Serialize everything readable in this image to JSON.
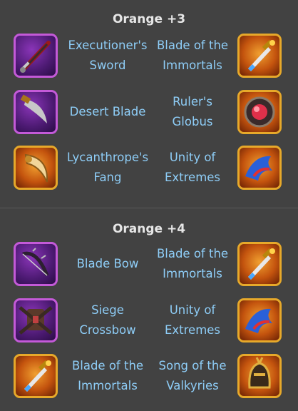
{
  "sections": [
    {
      "title": "Orange +3",
      "rows": [
        {
          "left": {
            "icon": "sword-icon",
            "name_lines": [
              "Executioner's",
              "Sword"
            ]
          },
          "right": {
            "icon": "dagger-icon",
            "name_lines": [
              "Blade of the",
              "Immortals"
            ]
          }
        },
        {
          "left": {
            "icon": "curved-blade-icon",
            "name_lines": [
              "Desert Blade"
            ]
          },
          "right": {
            "icon": "orb-icon",
            "name_lines": [
              "Ruler's",
              "Globus"
            ]
          }
        },
        {
          "left": {
            "icon": "fang-icon",
            "name_lines": [
              "Lycanthrope's",
              "Fang"
            ]
          },
          "right": {
            "icon": "dragon-icon",
            "name_lines": [
              "Unity of",
              "Extremes"
            ]
          }
        }
      ]
    },
    {
      "title": "Orange +4",
      "rows": [
        {
          "left": {
            "icon": "bow-icon",
            "name_lines": [
              "Blade Bow"
            ]
          },
          "right": {
            "icon": "dagger-icon",
            "name_lines": [
              "Blade of the",
              "Immortals"
            ]
          }
        },
        {
          "left": {
            "icon": "crossbow-icon",
            "name_lines": [
              "Siege",
              "Crossbow"
            ]
          },
          "right": {
            "icon": "dragon-icon",
            "name_lines": [
              "Unity of",
              "Extremes"
            ]
          }
        },
        {
          "left": {
            "icon": "dagger-icon",
            "name_lines": [
              "Blade of the",
              "Immortals"
            ]
          },
          "right": {
            "icon": "helmet-icon",
            "name_lines": [
              "Song of the",
              "Valkyries"
            ]
          }
        }
      ]
    }
  ],
  "colors": {
    "background": "#424242",
    "title_text": "#e6e6e6",
    "item_text": "#8ecdf7",
    "purple_frame": "#c45ad8",
    "orange_frame": "#e7a92a"
  }
}
